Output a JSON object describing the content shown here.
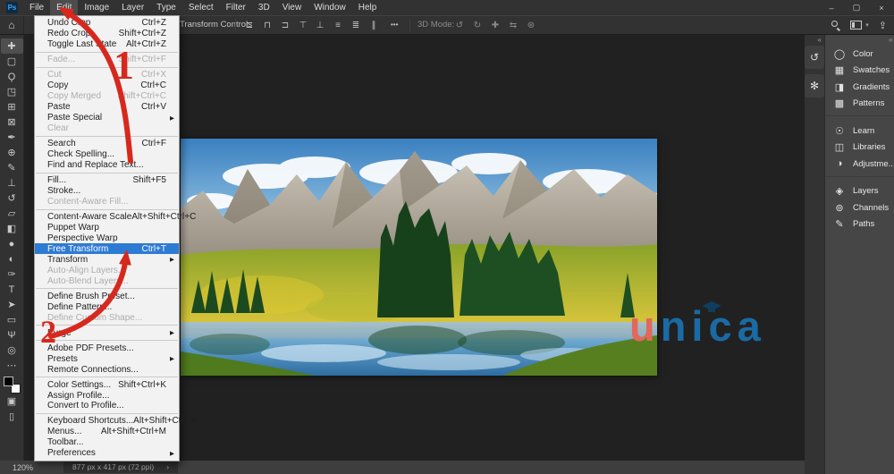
{
  "menubar": {
    "logo": "Ps",
    "items": [
      {
        "name": "menu-file",
        "label": "File"
      },
      {
        "name": "menu-edit",
        "label": "Edit",
        "state": "active"
      },
      {
        "name": "menu-image",
        "label": "Image"
      },
      {
        "name": "menu-layer",
        "label": "Layer"
      },
      {
        "name": "menu-type",
        "label": "Type"
      },
      {
        "name": "menu-select",
        "label": "Select"
      },
      {
        "name": "menu-filter",
        "label": "Filter"
      },
      {
        "name": "menu-3d",
        "label": "3D"
      },
      {
        "name": "menu-view",
        "label": "View"
      },
      {
        "name": "menu-window",
        "label": "Window"
      },
      {
        "name": "menu-help",
        "label": "Help"
      }
    ],
    "window_controls": [
      {
        "name": "minimize-button",
        "glyph": "–"
      },
      {
        "name": "restore-button",
        "glyph": "▢"
      },
      {
        "name": "close-button",
        "glyph": "×"
      }
    ]
  },
  "options_bar": {
    "home_icon": "⌂",
    "transform_controls_label": "Transform Controls",
    "align_icons": [
      {
        "name": "align-left-icon",
        "glyph": "⊏"
      },
      {
        "name": "align-center-horizontal-icon",
        "glyph": "⊓"
      },
      {
        "name": "align-right-icon",
        "glyph": "⊐"
      },
      {
        "name": "align-top-icon",
        "glyph": "⊤"
      }
    ],
    "distribute_icons": [
      {
        "name": "align-bottom-icon",
        "glyph": "⊥"
      },
      {
        "name": "distribute-vertical-icon",
        "glyph": "≡"
      },
      {
        "name": "distribute-horizontal-icon",
        "glyph": "≣"
      },
      {
        "name": "distribute-spacing-icon",
        "glyph": "∥"
      }
    ],
    "more_options": "•••",
    "mode_label": "3D Mode:",
    "mode_icons": [
      {
        "name": "3d-orbit-icon",
        "glyph": "↺"
      },
      {
        "name": "3d-roll-icon",
        "glyph": "↻"
      },
      {
        "name": "3d-pan-icon",
        "glyph": "✚"
      },
      {
        "name": "3d-slide-icon",
        "glyph": "⇆"
      },
      {
        "name": "3d-camera-icon",
        "glyph": "⊛"
      }
    ],
    "workspace_caret": "▾",
    "share_icon": "⇪"
  },
  "toolbar": {
    "tools": [
      {
        "name": "move-tool-button",
        "glyph": "✚",
        "state": "selected"
      },
      {
        "name": "rectangular-marquee-tool-button",
        "glyph": "▢"
      },
      {
        "name": "lasso-tool-button",
        "glyph": "Ϙ"
      },
      {
        "name": "object-selection-tool-button",
        "glyph": "◳"
      },
      {
        "name": "crop-tool-button",
        "glyph": "⊞"
      },
      {
        "name": "frame-tool-button",
        "glyph": "⊠"
      },
      {
        "name": "eyedropper-tool-button",
        "glyph": "✒"
      },
      {
        "name": "spot-healing-brush-tool-button",
        "glyph": "⊕"
      },
      {
        "name": "brush-tool-button",
        "glyph": "✎"
      },
      {
        "name": "clone-stamp-tool-button",
        "glyph": "⊥"
      },
      {
        "name": "history-brush-tool-button",
        "glyph": "↺"
      },
      {
        "name": "eraser-tool-button",
        "glyph": "▱"
      },
      {
        "name": "gradient-tool-button",
        "glyph": "◧"
      },
      {
        "name": "blur-tool-button",
        "glyph": "●"
      },
      {
        "name": "dodge-tool-button",
        "glyph": "◐"
      },
      {
        "name": "pen-tool-button",
        "glyph": "✑"
      },
      {
        "name": "type-tool-button",
        "glyph": "T"
      },
      {
        "name": "path-selection-tool-button",
        "glyph": "➤"
      },
      {
        "name": "rectangle-tool-button",
        "glyph": "▭"
      },
      {
        "name": "hand-tool-button",
        "glyph": "Ψ"
      },
      {
        "name": "zoom-tool-button",
        "glyph": "◎"
      },
      {
        "name": "edit-toolbar-button",
        "glyph": "⋯"
      }
    ],
    "quick_mask_glyph": "▣",
    "screen_mode_glyph": "▯"
  },
  "edit_menu": {
    "items": [
      {
        "name": "edit-undo-crop",
        "label": "Undo Crop",
        "shortcut": "Ctrl+Z"
      },
      {
        "name": "edit-redo-crop",
        "label": "Redo Crop",
        "shortcut": "Shift+Ctrl+Z"
      },
      {
        "name": "edit-toggle-last-state",
        "label": "Toggle Last State",
        "shortcut": "Alt+Ctrl+Z"
      },
      {
        "type": "separator"
      },
      {
        "name": "edit-fade",
        "label": "Fade...",
        "shortcut": "Shift+Ctrl+F",
        "state": "disabled"
      },
      {
        "type": "separator"
      },
      {
        "name": "edit-cut",
        "label": "Cut",
        "shortcut": "Ctrl+X",
        "state": "disabled"
      },
      {
        "name": "edit-copy",
        "label": "Copy",
        "shortcut": "Ctrl+C"
      },
      {
        "name": "edit-copy-merged",
        "label": "Copy Merged",
        "shortcut": "Shift+Ctrl+C",
        "state": "disabled"
      },
      {
        "name": "edit-paste",
        "label": "Paste",
        "shortcut": "Ctrl+V"
      },
      {
        "name": "edit-paste-special",
        "label": "Paste Special",
        "arrow": "▶"
      },
      {
        "name": "edit-clear",
        "label": "Clear",
        "state": "disabled"
      },
      {
        "type": "separator"
      },
      {
        "name": "edit-search",
        "label": "Search",
        "shortcut": "Ctrl+F"
      },
      {
        "name": "edit-check-spelling",
        "label": "Check Spelling..."
      },
      {
        "name": "edit-find-replace",
        "label": "Find and Replace Text..."
      },
      {
        "type": "separator"
      },
      {
        "name": "edit-fill",
        "label": "Fill...",
        "shortcut": "Shift+F5"
      },
      {
        "name": "edit-stroke",
        "label": "Stroke..."
      },
      {
        "name": "edit-content-aware-fill",
        "label": "Content-Aware Fill...",
        "state": "disabled"
      },
      {
        "type": "separator"
      },
      {
        "name": "edit-content-aware-scale",
        "label": "Content-Aware Scale",
        "shortcut": "Alt+Shift+Ctrl+C"
      },
      {
        "name": "edit-puppet-warp",
        "label": "Puppet Warp"
      },
      {
        "name": "edit-perspective-warp",
        "label": "Perspective Warp"
      },
      {
        "name": "edit-free-transform",
        "label": "Free Transform",
        "shortcut": "Ctrl+T",
        "state": "highlighted"
      },
      {
        "name": "edit-transform",
        "label": "Transform",
        "arrow": "▶"
      },
      {
        "name": "edit-auto-align-layers",
        "label": "Auto-Align Layers...",
        "state": "disabled"
      },
      {
        "name": "edit-auto-blend-layers",
        "label": "Auto-Blend Layers...",
        "state": "disabled"
      },
      {
        "type": "separator"
      },
      {
        "name": "edit-define-brush-preset",
        "label": "Define Brush Preset..."
      },
      {
        "name": "edit-define-pattern",
        "label": "Define Pattern..."
      },
      {
        "name": "edit-define-custom-shape",
        "label": "Define Custom Shape...",
        "state": "disabled"
      },
      {
        "type": "separator"
      },
      {
        "name": "edit-purge",
        "label": "Purge",
        "arrow": "▶"
      },
      {
        "type": "separator"
      },
      {
        "name": "edit-adobe-pdf-presets",
        "label": "Adobe PDF Presets..."
      },
      {
        "name": "edit-presets",
        "label": "Presets",
        "arrow": "▶"
      },
      {
        "name": "edit-remote-connections",
        "label": "Remote Connections..."
      },
      {
        "type": "separator"
      },
      {
        "name": "edit-color-settings",
        "label": "Color Settings...",
        "shortcut": "Shift+Ctrl+K"
      },
      {
        "name": "edit-assign-profile",
        "label": "Assign Profile..."
      },
      {
        "name": "edit-convert-to-profile",
        "label": "Convert to Profile..."
      },
      {
        "type": "separator"
      },
      {
        "name": "edit-keyboard-shortcuts",
        "label": "Keyboard Shortcuts...",
        "shortcut": "Alt+Shift+Ctrl+K"
      },
      {
        "name": "edit-menus",
        "label": "Menus...",
        "shortcut": "Alt+Shift+Ctrl+M"
      },
      {
        "name": "edit-toolbar",
        "label": "Toolbar..."
      },
      {
        "name": "edit-preferences",
        "label": "Preferences",
        "arrow": "▶"
      }
    ]
  },
  "right_panel": {
    "collapse_left": "«",
    "collapse_right": "«",
    "collapsed_icons": [
      {
        "name": "history-panel-button",
        "glyph": "↺"
      },
      {
        "name": "export-panel-button",
        "glyph": "✻"
      }
    ],
    "panels": [
      {
        "name": "panel-tab-color",
        "label": "Color",
        "glyph": "◯"
      },
      {
        "name": "panel-tab-swatches",
        "label": "Swatches",
        "glyph": "▦"
      },
      {
        "name": "panel-tab-gradients",
        "label": "Gradients",
        "glyph": "◨"
      },
      {
        "name": "panel-tab-patterns",
        "label": "Patterns",
        "glyph": "▩"
      },
      {
        "type": "separator"
      },
      {
        "name": "panel-tab-learn",
        "label": "Learn",
        "glyph": "☉"
      },
      {
        "name": "panel-tab-libraries",
        "label": "Libraries",
        "glyph": "◫"
      },
      {
        "name": "panel-tab-adjustments",
        "label": "Adjustme...",
        "glyph": "◑"
      },
      {
        "type": "separator"
      },
      {
        "name": "panel-tab-layers",
        "label": "Layers",
        "glyph": "◈"
      },
      {
        "name": "panel-tab-channels",
        "label": "Channels",
        "glyph": "⊚"
      },
      {
        "name": "panel-tab-paths",
        "label": "Paths",
        "glyph": "✎"
      }
    ]
  },
  "status_bar": {
    "zoom_level": "120%",
    "doc_info": "877 px x 417 px (72 ppi)",
    "chevron": "›"
  },
  "annotations": {
    "step_1": "1",
    "step_2": "2",
    "arrow_color": "#d7281e"
  },
  "watermark": {
    "prefix": "u",
    "suffix": "nica",
    "accent_color": "#e2685c",
    "brand_color": "#1a6aa3"
  }
}
